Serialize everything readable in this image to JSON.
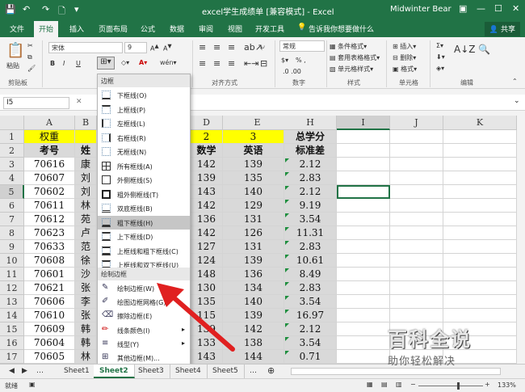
{
  "titlebar": {
    "title": "excel学生成绩单  [兼容模式]  -  Excel",
    "user": "Midwinter Bear",
    "restore_icon": "restore-icon",
    "minimize": "—",
    "maximize": "☐",
    "close": "✕"
  },
  "tabs": [
    {
      "label": "文件"
    },
    {
      "label": "开始"
    },
    {
      "label": "插入"
    },
    {
      "label": "页面布局"
    },
    {
      "label": "公式"
    },
    {
      "label": "数据"
    },
    {
      "label": "审阅"
    },
    {
      "label": "视图"
    },
    {
      "label": "开发工具"
    },
    {
      "label": "告诉我你想要做什么"
    }
  ],
  "share": "共享",
  "ribbon": {
    "paste": "粘贴",
    "clipboard_group": "剪贴板",
    "font_name": "宋体",
    "font_size": "9",
    "align_group": "对齐方式",
    "number_format": "常规",
    "percent": "% ,",
    "number_group": "数字",
    "cond_format": "条件格式",
    "table_format": "套用表格格式",
    "cell_style": "单元格样式",
    "style_group": "样式",
    "insert": "插入",
    "delete": "删除",
    "format": "格式",
    "cells_group": "单元格",
    "edit_group": "编辑"
  },
  "formula": {
    "namebox": "I5",
    "fx": "fx"
  },
  "columns": [
    "A",
    "B",
    "C",
    "D",
    "E",
    "H",
    "I",
    "J",
    "K"
  ],
  "rows": [
    {
      "n": "1",
      "a": "权重",
      "b": "",
      "d": "2",
      "e": "3",
      "h": "总学分"
    },
    {
      "n": "2",
      "a": "考号",
      "b": "姓",
      "d": "数学",
      "e": "英语",
      "h": "标准差"
    },
    {
      "n": "3",
      "a": "70616",
      "b": "康",
      "d": "142",
      "e": "139",
      "h": "2.12"
    },
    {
      "n": "4",
      "a": "70607",
      "b": "刘",
      "d": "139",
      "e": "135",
      "h": "2.83"
    },
    {
      "n": "5",
      "a": "70602",
      "b": "刘",
      "d": "143",
      "e": "140",
      "h": "2.12"
    },
    {
      "n": "6",
      "a": "70611",
      "b": "林",
      "d": "142",
      "e": "129",
      "h": "9.19"
    },
    {
      "n": "7",
      "a": "70612",
      "b": "苑",
      "d": "136",
      "e": "131",
      "h": "3.54"
    },
    {
      "n": "8",
      "a": "70623",
      "b": "卢",
      "d": "142",
      "e": "126",
      "h": "11.31"
    },
    {
      "n": "9",
      "a": "70633",
      "b": "范",
      "d": "127",
      "e": "131",
      "h": "2.83"
    },
    {
      "n": "10",
      "a": "70608",
      "b": "徐",
      "d": "124",
      "e": "139",
      "h": "10.61"
    },
    {
      "n": "11",
      "a": "70601",
      "b": "沙",
      "d": "148",
      "e": "136",
      "h": "8.49"
    },
    {
      "n": "12",
      "a": "70621",
      "b": "张",
      "d": "130",
      "e": "134",
      "h": "2.83"
    },
    {
      "n": "13",
      "a": "70606",
      "b": "李",
      "d": "135",
      "e": "140",
      "h": "3.54"
    },
    {
      "n": "14",
      "a": "70610",
      "b": "张",
      "d": "115",
      "e": "139",
      "h": "16.97"
    },
    {
      "n": "15",
      "a": "70609",
      "b": "韩",
      "d": "139",
      "e": "142",
      "h": "2.12"
    },
    {
      "n": "16",
      "a": "70604",
      "b": "韩",
      "d": "133",
      "e": "138",
      "h": "3.54"
    },
    {
      "n": "17",
      "a": "70605",
      "b": "林",
      "d": "143",
      "e": "144",
      "h": "0.71"
    }
  ],
  "menu": {
    "header1": "边框",
    "items1": [
      {
        "label": "下框线(O)",
        "icon": "bottom-border-icon"
      },
      {
        "label": "上框线(P)",
        "icon": "top-border-icon"
      },
      {
        "label": "左框线(L)",
        "icon": "left-border-icon"
      },
      {
        "label": "右框线(R)",
        "icon": "right-border-icon"
      },
      {
        "label": "无框线(N)",
        "icon": "no-border-icon"
      },
      {
        "label": "所有框线(A)",
        "icon": "all-borders-icon"
      },
      {
        "label": "外侧框线(S)",
        "icon": "outside-borders-icon"
      },
      {
        "label": "粗外侧框线(T)",
        "icon": "thick-outside-border-icon"
      },
      {
        "label": "双底框线(B)",
        "icon": "double-bottom-border-icon"
      },
      {
        "label": "粗下框线(H)",
        "icon": "thick-bottom-border-icon"
      },
      {
        "label": "上下框线(D)",
        "icon": "top-bottom-border-icon"
      },
      {
        "label": "上框线和粗下框线(C)",
        "icon": "top-thick-bottom-border-icon"
      },
      {
        "label": "上框线和双下框线(U)",
        "icon": "top-double-bottom-border-icon"
      }
    ],
    "header2": "绘制边框",
    "items2": [
      {
        "label": "绘制边框(W)",
        "icon": "draw-border-icon"
      },
      {
        "label": "绘图边框网格(G)",
        "icon": "draw-border-grid-icon"
      },
      {
        "label": "擦除边框(E)",
        "icon": "eraser-icon"
      },
      {
        "label": "线条颜色(I)",
        "icon": "line-color-icon"
      },
      {
        "label": "线型(Y)",
        "icon": "line-style-icon"
      },
      {
        "label": "其他边框(M)...",
        "icon": "more-borders-icon"
      }
    ]
  },
  "sheets": [
    "Sheet1",
    "Sheet2",
    "Sheet3",
    "Sheet4",
    "Sheet5"
  ],
  "active_sheet": "Sheet2",
  "status": {
    "ready": "就绪",
    "zoom": "133%"
  },
  "watermark": {
    "title": "百科全说",
    "subtitle": "助你轻松解决"
  },
  "colors": {
    "excel_green": "#217346",
    "highlight_yellow": "#ffff00",
    "arrow_red": "#e02020"
  }
}
